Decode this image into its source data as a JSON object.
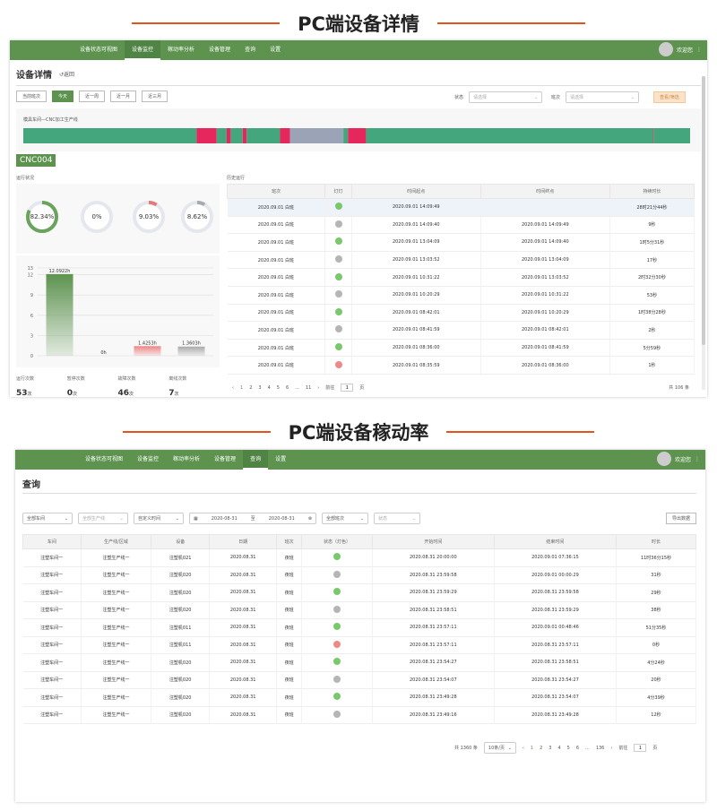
{
  "banner1": {
    "title": "PC端设备详情"
  },
  "banner2": {
    "title": "PC端设备稼动率"
  },
  "nav": {
    "items": [
      "设备状态可视图",
      "设备监控",
      "稼动率分析",
      "设备管理",
      "查询",
      "设置"
    ],
    "active1": 1,
    "active2": 4,
    "user": "欢迎您"
  },
  "detail": {
    "title": "设备详情",
    "back": "返回",
    "ranges": [
      "当前班次",
      "今天",
      "近一周",
      "近一月",
      "近三月"
    ],
    "status_label": "状态",
    "status_placeholder": "请选择",
    "shift_label": "班次",
    "shift_placeholder": "请选择",
    "query_btn": "查看/筛选",
    "line_path": "模具车间—CNC加工生产线",
    "timeline_colors": {
      "run": "#44a67c",
      "stop": "#e5275e",
      "idle": "#9ba4b6"
    },
    "machine": "CNC004",
    "run_status_label": "运行状况",
    "history_label": "历史运行",
    "gauges": [
      {
        "label": "82.34%",
        "value": 82.34,
        "color": "#6aa35c"
      },
      {
        "label": "0%",
        "value": 0,
        "color": "#6aa35c"
      },
      {
        "label": "9.03%",
        "value": 9.03,
        "color": "#e27a7a"
      },
      {
        "label": "8.62%",
        "value": 8.62,
        "color": "#aaaaaa"
      }
    ],
    "counts": [
      {
        "label": "运行次数",
        "value": "53",
        "unit": "次"
      },
      {
        "label": "暂停次数",
        "value": "0",
        "unit": "次"
      },
      {
        "label": "故障次数",
        "value": "46",
        "unit": "次"
      },
      {
        "label": "离线次数",
        "value": "7",
        "unit": "次"
      }
    ],
    "history_headers": [
      "班次",
      "灯灯",
      "时间起点",
      "时间终点",
      "持续时长"
    ],
    "history_rows": [
      {
        "shift": "2020.09.01 白班",
        "status": "green",
        "start": "2020.09.01 14:09:49",
        "end": "",
        "dur": "28时21分44秒"
      },
      {
        "shift": "2020.09.01 白班",
        "status": "gray",
        "start": "2020.09.01 14:09:40",
        "end": "2020.09.01 14:09:49",
        "dur": "9秒"
      },
      {
        "shift": "2020.09.01 白班",
        "status": "green",
        "start": "2020.09.01 13:04:09",
        "end": "2020.09.01 14:09:40",
        "dur": "1时5分31秒"
      },
      {
        "shift": "2020.09.01 白班",
        "status": "gray",
        "start": "2020.09.01 13:03:52",
        "end": "2020.09.01 13:04:09",
        "dur": "17秒"
      },
      {
        "shift": "2020.09.01 白班",
        "status": "green",
        "start": "2020.09.01 10:31:22",
        "end": "2020.09.01 13:03:52",
        "dur": "2时32分30秒"
      },
      {
        "shift": "2020.09.01 白班",
        "status": "gray",
        "start": "2020.09.01 10:20:29",
        "end": "2020.09.01 10:31:22",
        "dur": "53秒"
      },
      {
        "shift": "2020.09.01 白班",
        "status": "green",
        "start": "2020.09.01 08:42:01",
        "end": "2020.09.01 10:20:29",
        "dur": "1时38分28秒"
      },
      {
        "shift": "2020.09.01 白班",
        "status": "gray",
        "start": "2020.09.01 08:41:59",
        "end": "2020.09.01 08:42:01",
        "dur": "2秒"
      },
      {
        "shift": "2020.09.01 白班",
        "status": "green",
        "start": "2020.09.01 08:36:00",
        "end": "2020.09.01 08:41:59",
        "dur": "5分59秒"
      },
      {
        "shift": "2020.09.01 白班",
        "status": "red",
        "start": "2020.09.01 08:35:59",
        "end": "2020.09.01 08:36:00",
        "dur": "1秒"
      }
    ],
    "pager": {
      "pages": [
        "1",
        "2",
        "3",
        "4",
        "5",
        "6",
        "...",
        "11"
      ],
      "goto": "前往",
      "page": "1",
      "page_unit": "页",
      "total": "共 106 条"
    }
  },
  "chart_data": {
    "type": "bar",
    "categories": [
      "运行",
      "暂停",
      "故障",
      "离线"
    ],
    "values": [
      12.0922,
      0,
      1.4253,
      1.3603
    ],
    "value_labels": [
      "12.0922h",
      "0h",
      "1.4253h",
      "1.3603h"
    ],
    "colors": [
      "#5d934f",
      "#5d934f",
      "#ee8585",
      "#aaaaaa"
    ],
    "ylim": [
      0,
      13
    ],
    "yticks": [
      0,
      3,
      6,
      9,
      12,
      13
    ]
  },
  "query": {
    "title": "查询",
    "filters": [
      "全部车间",
      "全部生产线",
      "自定义时间",
      "全部班次",
      "状态"
    ],
    "date_from": "2020-08-31",
    "date_sep": "至",
    "date_to": "2020-08-31",
    "export": "导出数据",
    "headers": [
      "车间",
      "生产线/区域",
      "设备",
      "日期",
      "班次",
      "状态（灯色）",
      "开始时间",
      "结束时间",
      "时长"
    ],
    "rows": [
      {
        "ws": "注塑车间一",
        "line": "注塑生产线一",
        "dev": "注塑机021",
        "date": "2020.08.31",
        "shift": "夜班",
        "status": "green",
        "start": "2020.08.31 20:00:00",
        "end": "2020.09.01 07:36:15",
        "dur": "11时36分15秒"
      },
      {
        "ws": "注塑车间一",
        "line": "注塑生产线一",
        "dev": "注塑机020",
        "date": "2020.08.31",
        "shift": "夜班",
        "status": "gray",
        "start": "2020.08.31 23:59:58",
        "end": "2020.09.01 00:00:29",
        "dur": "31秒"
      },
      {
        "ws": "注塑车间一",
        "line": "注塑生产线一",
        "dev": "注塑机020",
        "date": "2020.08.31",
        "shift": "夜班",
        "status": "green",
        "start": "2020.08.31 23:59:29",
        "end": "2020.08.31 23:59:58",
        "dur": "29秒"
      },
      {
        "ws": "注塑车间一",
        "line": "注塑生产线一",
        "dev": "注塑机020",
        "date": "2020.08.31",
        "shift": "夜班",
        "status": "gray",
        "start": "2020.08.31 23:58:51",
        "end": "2020.08.31 23:59:29",
        "dur": "38秒"
      },
      {
        "ws": "注塑车间一",
        "line": "注塑生产线一",
        "dev": "注塑机011",
        "date": "2020.08.31",
        "shift": "夜班",
        "status": "green",
        "start": "2020.08.31 23:57:11",
        "end": "2020.09.01 00:48:46",
        "dur": "51分35秒"
      },
      {
        "ws": "注塑车间一",
        "line": "注塑生产线一",
        "dev": "注塑机011",
        "date": "2020.08.31",
        "shift": "夜班",
        "status": "red",
        "start": "2020.08.31 23:57:11",
        "end": "2020.08.31 23:57:11",
        "dur": "0秒"
      },
      {
        "ws": "注塑车间一",
        "line": "注塑生产线一",
        "dev": "注塑机020",
        "date": "2020.08.31",
        "shift": "夜班",
        "status": "green",
        "start": "2020.08.31 23:54:27",
        "end": "2020.08.31 23:58:51",
        "dur": "4分24秒"
      },
      {
        "ws": "注塑车间一",
        "line": "注塑生产线一",
        "dev": "注塑机020",
        "date": "2020.08.31",
        "shift": "夜班",
        "status": "gray",
        "start": "2020.08.31 23:54:07",
        "end": "2020.08.31 23:54:27",
        "dur": "20秒"
      },
      {
        "ws": "注塑车间一",
        "line": "注塑生产线一",
        "dev": "注塑机020",
        "date": "2020.08.31",
        "shift": "夜班",
        "status": "green",
        "start": "2020.08.31 23:49:28",
        "end": "2020.08.31 23:54:07",
        "dur": "4分39秒"
      },
      {
        "ws": "注塑车间一",
        "line": "注塑生产线一",
        "dev": "注塑机020",
        "date": "2020.08.31",
        "shift": "夜班",
        "status": "gray",
        "start": "2020.08.31 23:49:16",
        "end": "2020.08.31 23:49:28",
        "dur": "12秒"
      }
    ],
    "pager": {
      "total": "共 1360 条",
      "per_page": "10条/页",
      "pages": [
        "1",
        "2",
        "3",
        "4",
        "5",
        "6",
        "...",
        "136"
      ],
      "goto": "前往",
      "page": "1",
      "page_unit": "页"
    }
  }
}
